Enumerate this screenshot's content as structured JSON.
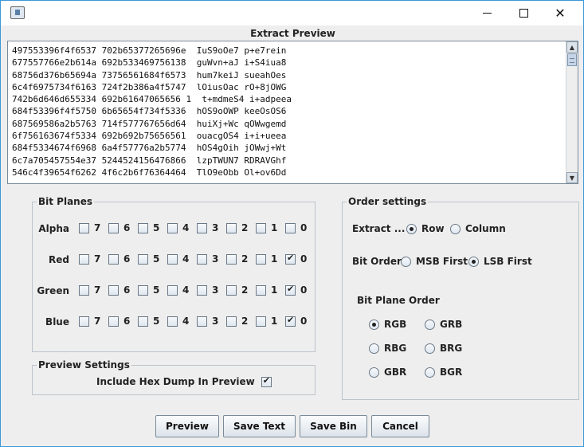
{
  "window": {
    "icon": "java-app-icon",
    "controls": [
      "minimize-icon",
      "maximize-icon",
      "close-icon"
    ]
  },
  "preview": {
    "title": "Extract Preview",
    "lines": [
      "497553396f4f6537 702b65377265696e  IuS9oOe7 p+e7rein",
      "677557766e2b614a 692b533469756138  guWvn+aJ i+S4iua8",
      "68756d376b65694a 73756561684f6573  hum7keiJ sueahOes",
      "6c4f6975734f6163 724f2b386a4f5747  lOiusOac rO+8jOWG",
      "742b6d646d655334 692b61647065656 1  t+mdmeS4 i+adpeea",
      "684f53396f4f5750 6b65654f734f5336  hOS9oOWP keeOsOS6",
      "687569586a2b5763 714f577767656d64  huiXj+Wc qOWwgemd",
      "6f756163674f5334 692b692b75656561  ouacgOS4 i+i+ueea",
      "684f5334674f6968 6a4f57776a2b5774  hOS4gOih jOWwj+Wt",
      "6c7a705457554e37 5244524156476866  lzpTWUN7 RDRAVGhf",
      "546c4f39654f6262 4f6c2b6f76364464  TlO9eObb Ol+ov6Dd"
    ]
  },
  "bit_planes": {
    "title": "Bit Planes",
    "bits": [
      "7",
      "6",
      "5",
      "4",
      "3",
      "2",
      "1",
      "0"
    ],
    "rows": [
      {
        "label": "Alpha",
        "checked": [
          false,
          false,
          false,
          false,
          false,
          false,
          false,
          false
        ]
      },
      {
        "label": "Red",
        "checked": [
          false,
          false,
          false,
          false,
          false,
          false,
          false,
          true
        ]
      },
      {
        "label": "Green",
        "checked": [
          false,
          false,
          false,
          false,
          false,
          false,
          false,
          true
        ]
      },
      {
        "label": "Blue",
        "checked": [
          false,
          false,
          false,
          false,
          false,
          false,
          false,
          true
        ]
      }
    ]
  },
  "preview_settings": {
    "title": "Preview Settings",
    "hex_dump_label": "Include Hex Dump In Preview",
    "hex_dump_checked": true
  },
  "order_settings": {
    "title": "Order settings",
    "extract_label": "Extract ...",
    "extract_options": [
      {
        "label": "Row",
        "selected": true
      },
      {
        "label": "Column",
        "selected": false
      }
    ],
    "bit_order_label": "Bit Order",
    "bit_order_options": [
      {
        "label": "MSB First",
        "selected": false
      },
      {
        "label": "LSB First",
        "selected": true
      }
    ],
    "plane_order_label": "Bit Plane Order",
    "plane_order_options": [
      {
        "label": "RGB",
        "selected": true
      },
      {
        "label": "GRB",
        "selected": false
      },
      {
        "label": "RBG",
        "selected": false
      },
      {
        "label": "BRG",
        "selected": false
      },
      {
        "label": "GBR",
        "selected": false
      },
      {
        "label": "BGR",
        "selected": false
      }
    ]
  },
  "buttons": {
    "preview": "Preview",
    "save_text": "Save Text",
    "save_bin": "Save Bin",
    "cancel": "Cancel"
  }
}
